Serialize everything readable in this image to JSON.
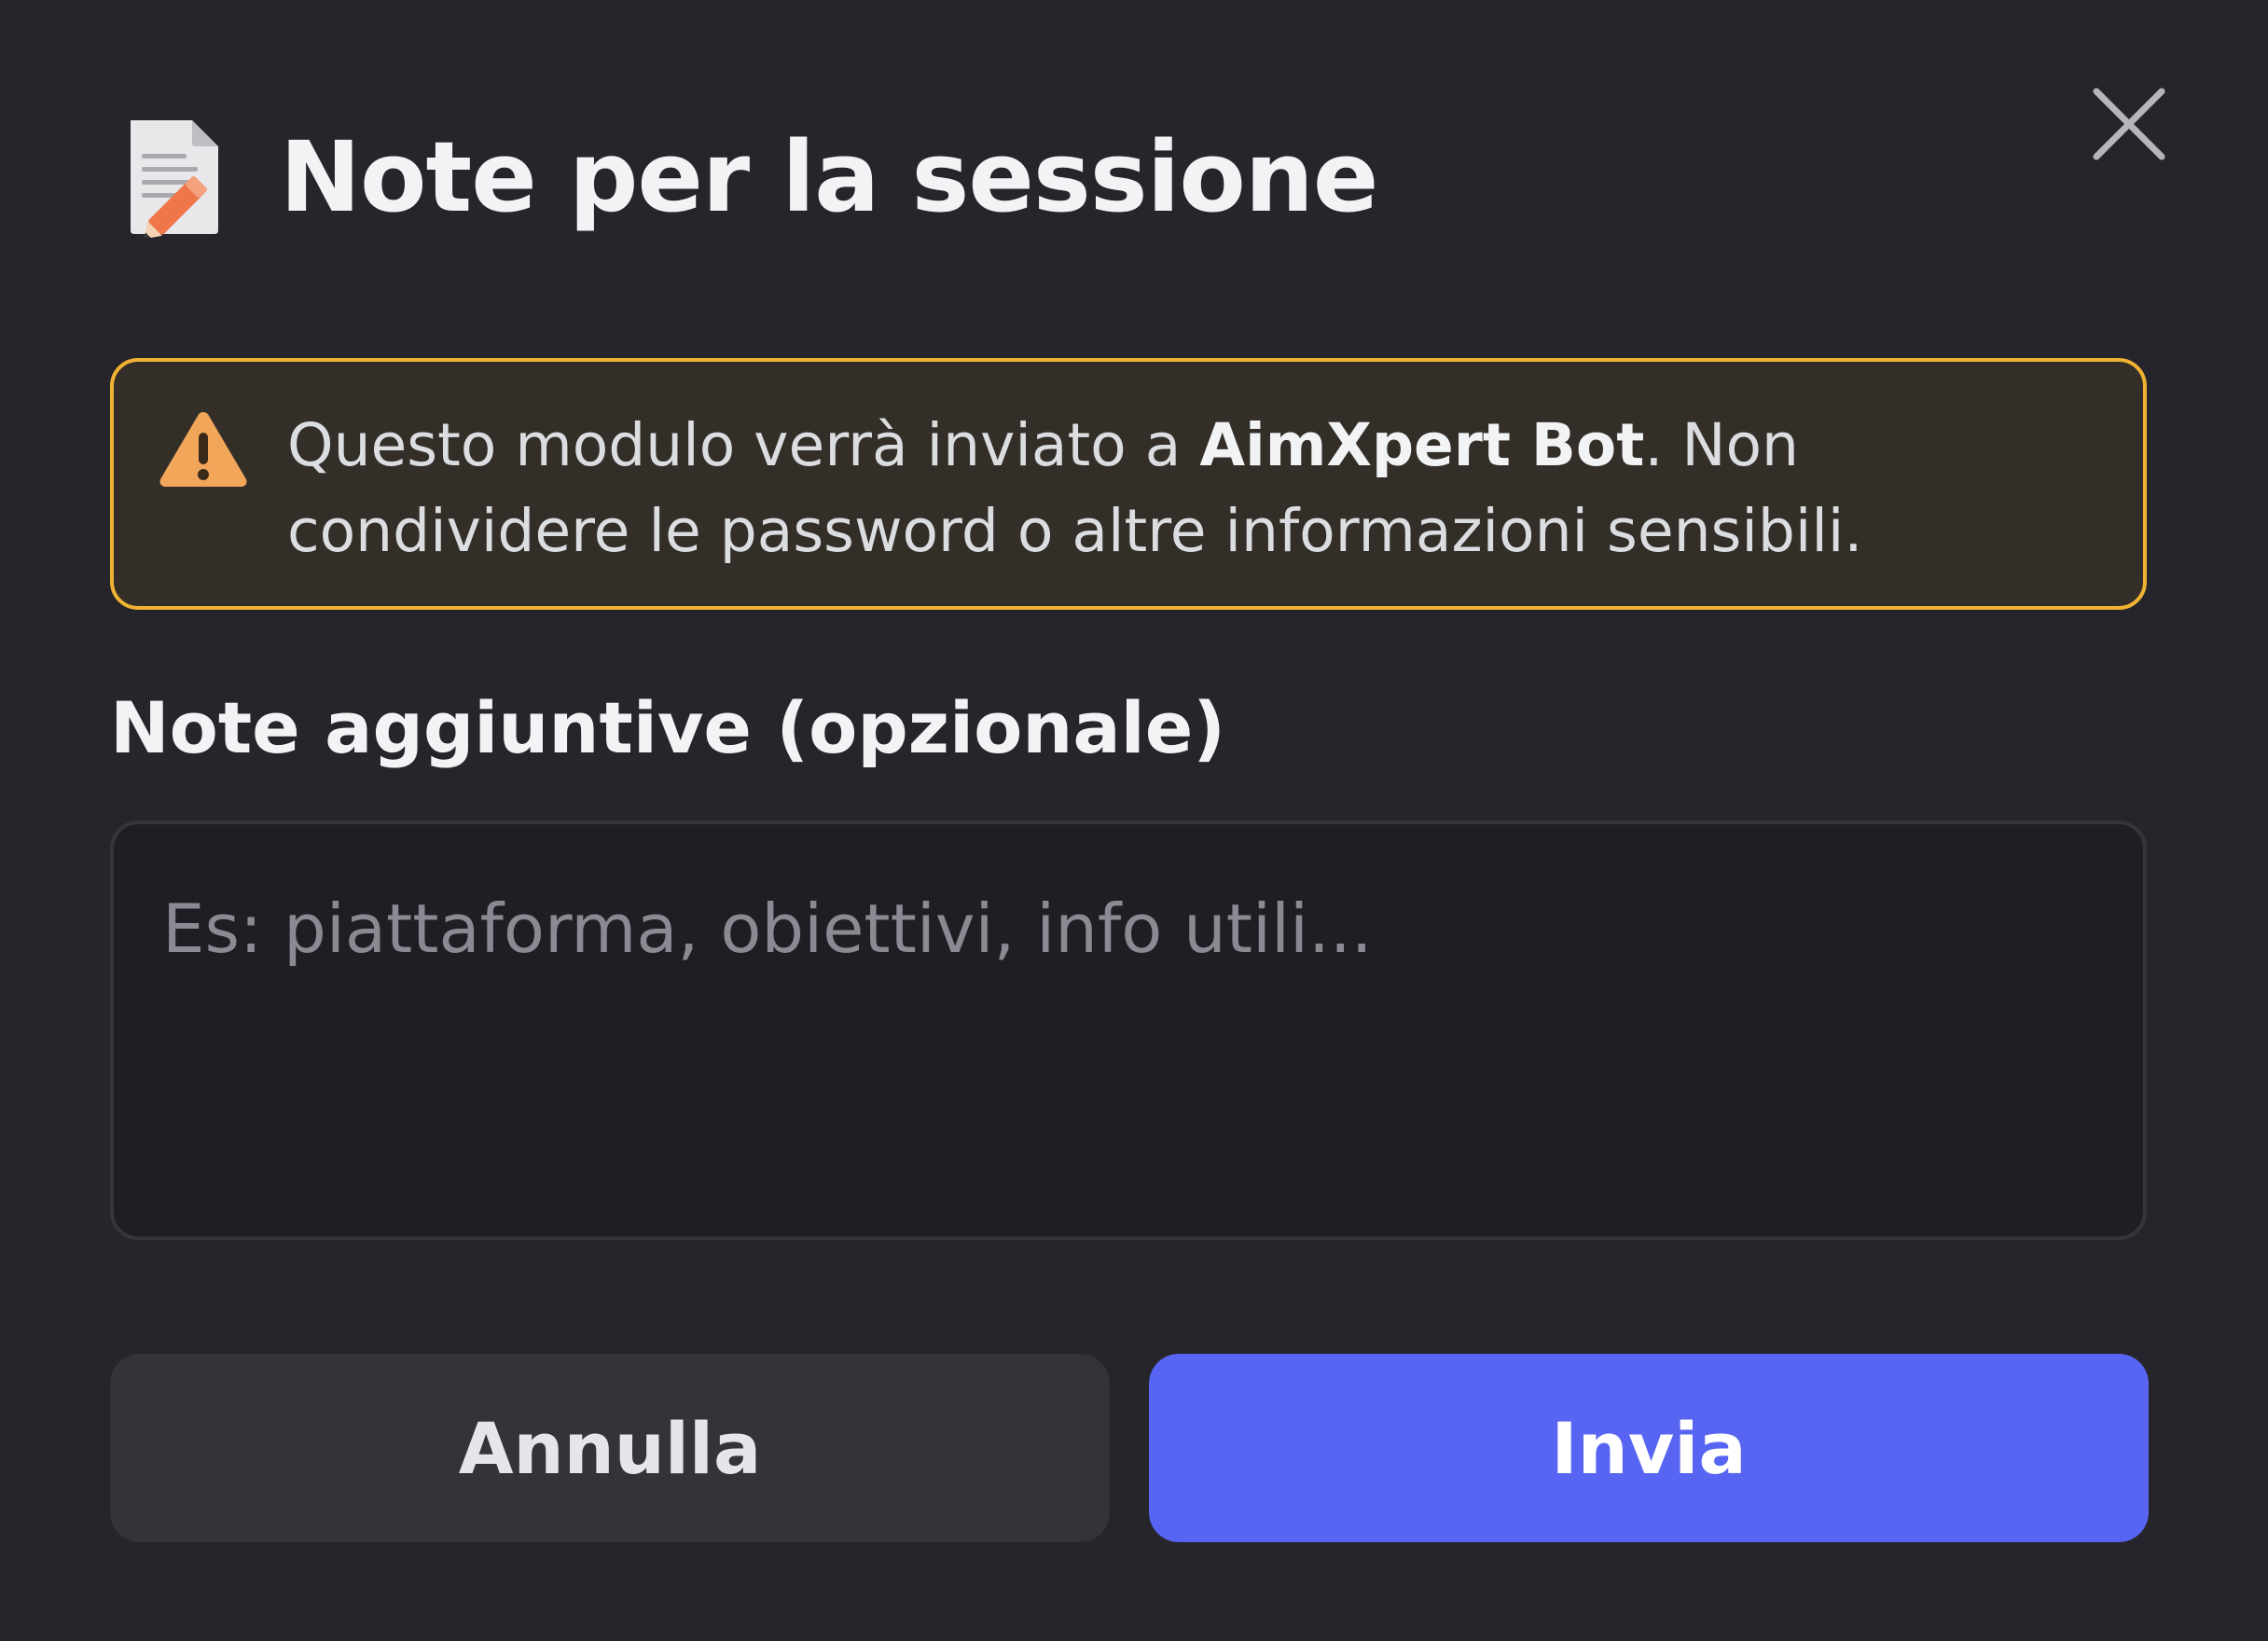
{
  "colors": {
    "background": "#26252b",
    "warning_border": "#f0b232",
    "warning_background": "#332f28",
    "primary_button": "#5865f2",
    "secondary_button": "#34333a",
    "input_background": "#1f1e24"
  },
  "header": {
    "icon": "memo-icon",
    "title": "Note per la sessione",
    "close_icon": "close-icon"
  },
  "warning": {
    "icon": "warning-icon",
    "text_before": "Questo modulo verrà inviato a ",
    "bot_name": "AimXpert Bot",
    "text_after": ". Non condividere le password o altre informazioni sensibili."
  },
  "notes_field": {
    "label": "Note aggiuntive (opzionale)",
    "placeholder": "Es: piattaforma, obiettivi, info utili...",
    "value": ""
  },
  "actions": {
    "cancel_label": "Annulla",
    "submit_label": "Invia"
  }
}
